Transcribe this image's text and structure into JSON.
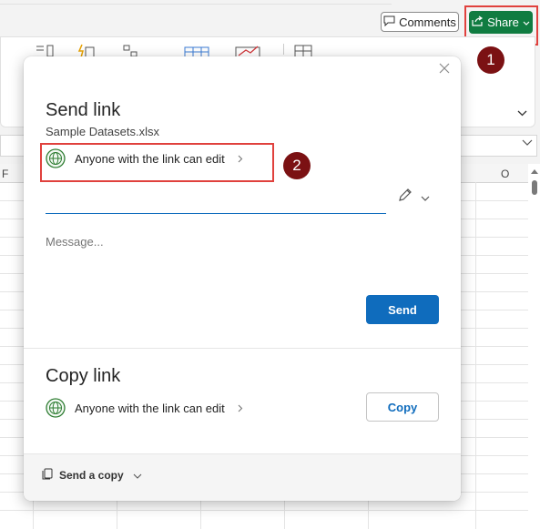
{
  "toolbar": {
    "comments_label": "Comments",
    "share_label": "Share",
    "share_color": "#107c41"
  },
  "grid": {
    "columns": [
      "F",
      "O"
    ]
  },
  "callouts": [
    "1",
    "2"
  ],
  "dialog": {
    "title": "Send link",
    "filename": "Sample Datasets.xlsx",
    "permission_label": "Anyone with the link can edit",
    "to_placeholder": "",
    "message_placeholder": "Message...",
    "send_label": "Send",
    "copy_title": "Copy link",
    "copy_permission_label": "Anyone with the link can edit",
    "copy_label": "Copy",
    "send_copy_label": "Send a copy",
    "accent_color": "#0f6cbd",
    "highlight_color": "#e0413d",
    "icons": [
      "close-icon",
      "globe-icon",
      "chevron-right-icon",
      "pencil-icon",
      "chevron-down-icon",
      "send-copy-icon"
    ]
  }
}
